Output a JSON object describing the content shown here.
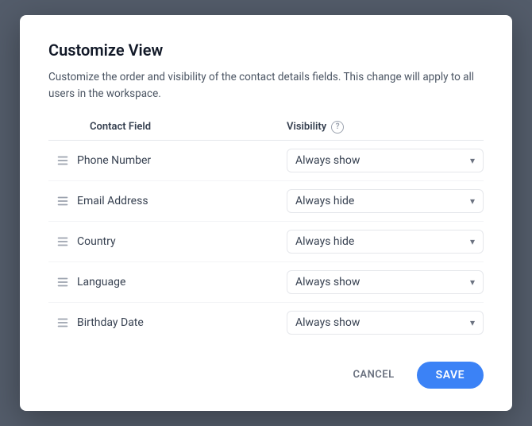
{
  "modal": {
    "title": "Customize View",
    "description": "Customize the order and visibility of the contact details fields. This change will apply to all users in the workspace.",
    "table": {
      "col_field_label": "Contact Field",
      "col_visibility_label": "Visibility",
      "rows": [
        {
          "id": "phone-number",
          "field": "Phone Number",
          "visibility": "Always show"
        },
        {
          "id": "email-address",
          "field": "Email Address",
          "visibility": "Always hide"
        },
        {
          "id": "country",
          "field": "Country",
          "visibility": "Always hide"
        },
        {
          "id": "language",
          "field": "Language",
          "visibility": "Always show"
        },
        {
          "id": "birthday-date",
          "field": "Birthday Date",
          "visibility": "Always show"
        }
      ]
    },
    "footer": {
      "cancel_label": "CANCEL",
      "save_label": "SAVE"
    }
  }
}
